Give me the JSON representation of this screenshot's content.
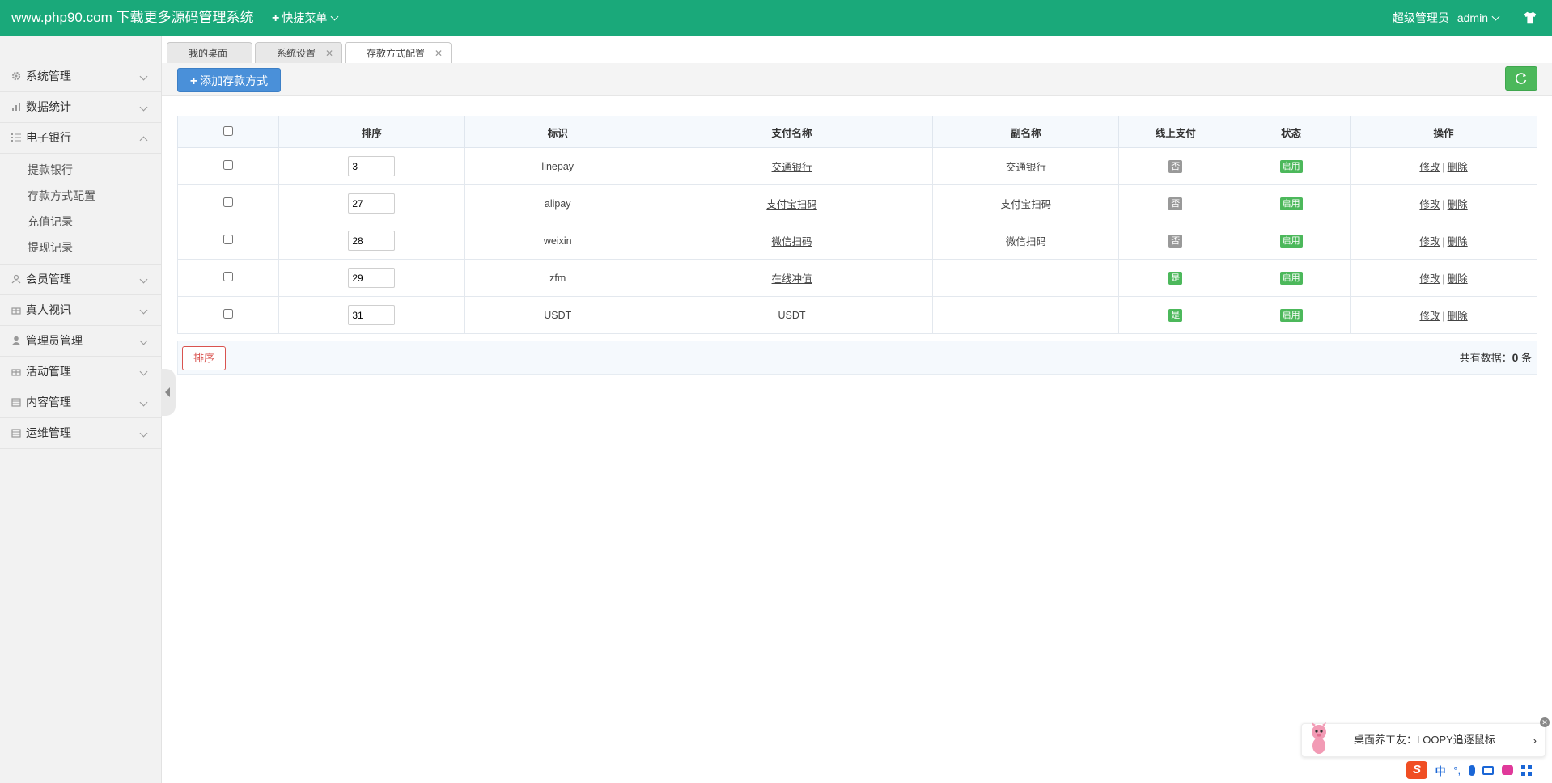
{
  "header": {
    "brand": "www.php90.com 下载更多源码管理系统",
    "quick_menu": "快捷菜单",
    "role": "超级管理员",
    "user": "admin"
  },
  "sidebar": {
    "items": [
      {
        "label": "系统管理",
        "icon": "gear-icon"
      },
      {
        "label": "数据统计",
        "icon": "chart-icon"
      },
      {
        "label": "电子银行",
        "icon": "list-icon",
        "expanded": true
      },
      {
        "label": "会员管理",
        "icon": "user-icon"
      },
      {
        "label": "真人视讯",
        "icon": "gift-icon"
      },
      {
        "label": "管理员管理",
        "icon": "person-icon"
      },
      {
        "label": "活动管理",
        "icon": "gift-icon"
      },
      {
        "label": "内容管理",
        "icon": "building-icon"
      },
      {
        "label": "运维管理",
        "icon": "building-icon"
      }
    ],
    "sub_items": [
      "提款银行",
      "存款方式配置",
      "充值记录",
      "提现记录"
    ]
  },
  "tabs": [
    {
      "label": "我的桌面",
      "closable": false
    },
    {
      "label": "系统设置",
      "closable": true
    },
    {
      "label": "存款方式配置",
      "closable": true,
      "active": true
    }
  ],
  "toolbar": {
    "add_label": "添加存款方式",
    "colors": {
      "add": "#4a90d9",
      "refresh": "#4cb85b",
      "header": "#1aa97a"
    }
  },
  "table": {
    "headers": [
      "排序",
      "标识",
      "支付名称",
      "副名称",
      "线上支付",
      "状态",
      "操作"
    ],
    "rows": [
      {
        "sort": "3",
        "code": "linepay",
        "name": "交通银行",
        "subname": "交通银行",
        "online": "否",
        "status": "启用"
      },
      {
        "sort": "27",
        "code": "alipay",
        "name": "支付宝扫码",
        "subname": "支付宝扫码",
        "online": "否",
        "status": "启用"
      },
      {
        "sort": "28",
        "code": "weixin",
        "name": "微信扫码",
        "subname": "微信扫码",
        "online": "否",
        "status": "启用"
      },
      {
        "sort": "29",
        "code": "zfm",
        "name": "在线冲值",
        "subname": "",
        "online": "是",
        "status": "启用"
      },
      {
        "sort": "31",
        "code": "USDT",
        "name": "USDT",
        "subname": "",
        "online": "是",
        "status": "启用"
      }
    ],
    "edit_label": "修改",
    "delete_label": "删除",
    "separator": "|"
  },
  "footer": {
    "sort_button": "排序",
    "total_prefix": "共有数据：",
    "total_count": "0",
    "total_suffix": " 条"
  },
  "notification": {
    "text": "桌面养工友：LOOPY追逐鼠标",
    "arrow": "›"
  },
  "ime": {
    "logo": "S",
    "lang": "中",
    "punct": "°,"
  }
}
